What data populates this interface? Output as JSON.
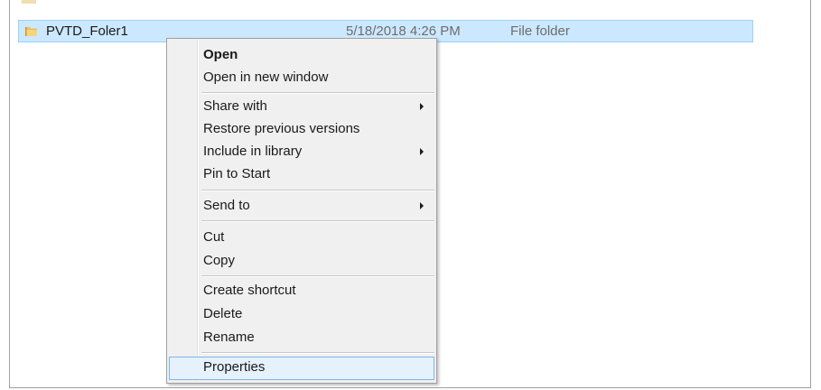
{
  "file": {
    "name": "PVTD_Foler1",
    "date": "5/18/2018 4:26 PM",
    "type": "File folder",
    "icon": "folder-icon"
  },
  "menu": {
    "items": [
      {
        "label": "Open",
        "bold": true
      },
      {
        "label": "Open in new window"
      },
      {
        "label": "Share with",
        "submenu": true
      },
      {
        "label": "Restore previous versions"
      },
      {
        "label": "Include in library",
        "submenu": true
      },
      {
        "label": "Pin to Start"
      },
      {
        "label": "Send to",
        "submenu": true
      },
      {
        "label": "Cut"
      },
      {
        "label": "Copy"
      },
      {
        "label": "Create shortcut"
      },
      {
        "label": "Delete"
      },
      {
        "label": "Rename"
      },
      {
        "label": "Properties",
        "highlighted": true
      }
    ]
  },
  "colors": {
    "selection_bg": "#cce8ff",
    "selection_border": "#99d1ff",
    "menu_bg": "#f0f0f0",
    "highlight_bg": "#e5f1fb",
    "highlight_border": "#7eb4ea"
  }
}
